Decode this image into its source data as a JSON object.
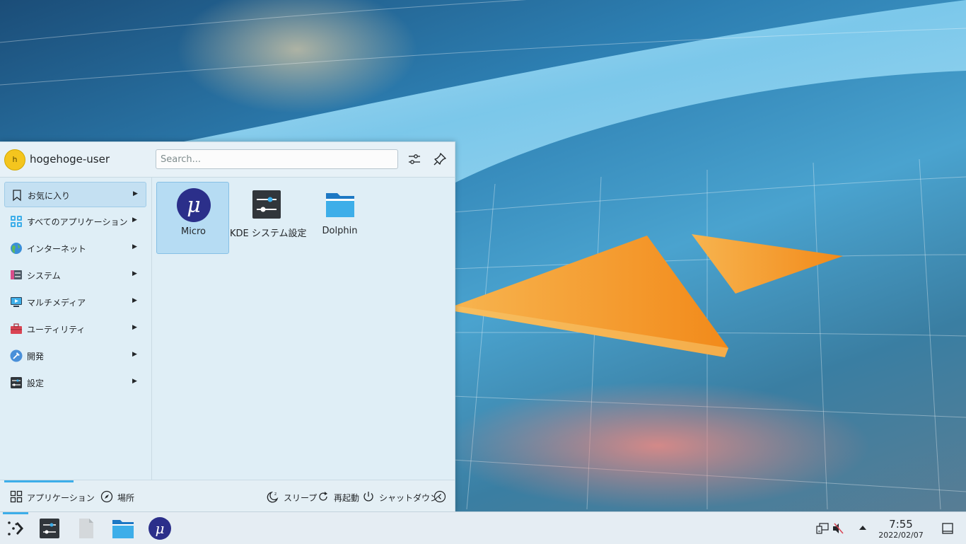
{
  "launcher": {
    "username": "hogehoge-user",
    "avatar_letter": "h",
    "search_placeholder": "Search...",
    "categories": [
      {
        "label": "お気に入り",
        "icon": "bookmark-icon"
      },
      {
        "label": "すべてのアプリケーション",
        "icon": "grid-icon"
      },
      {
        "label": "インターネット",
        "icon": "globe-icon"
      },
      {
        "label": "システム",
        "icon": "system-icon"
      },
      {
        "label": "マルチメディア",
        "icon": "multimedia-icon"
      },
      {
        "label": "ユーティリティ",
        "icon": "toolbox-icon"
      },
      {
        "label": "開発",
        "icon": "development-icon"
      },
      {
        "label": "設定",
        "icon": "settings-icon"
      }
    ],
    "apps": [
      {
        "label": "Micro",
        "icon": "micro-icon"
      },
      {
        "label": "KDE システム設定",
        "icon": "system-settings-icon"
      },
      {
        "label": "Dolphin",
        "icon": "folder-icon"
      }
    ],
    "footer": {
      "applications": "アプリケーション",
      "places": "場所",
      "sleep": "スリープ",
      "restart": "再起動",
      "shutdown": "シャットダウン"
    }
  },
  "taskbar": {
    "time": "7:55",
    "date": "2022/02/07"
  },
  "colors": {
    "accent": "#3daee9",
    "avatar": "#f4c51e",
    "micro": "#2b2f8a"
  }
}
